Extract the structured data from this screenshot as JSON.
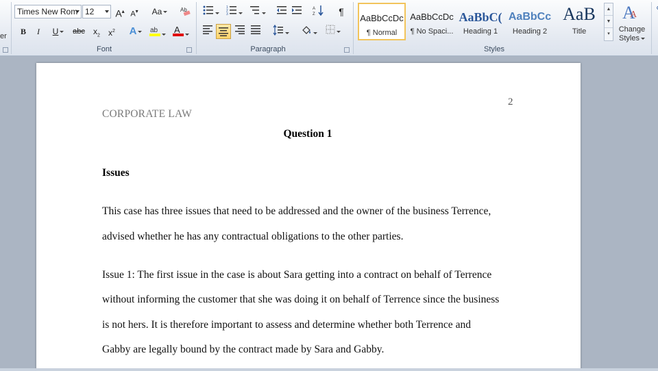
{
  "ribbon": {
    "clipboard_partial_label": "er",
    "font": {
      "family": "Times New Rom",
      "size": "12",
      "group_label": "Font"
    },
    "paragraph": {
      "group_label": "Paragraph"
    },
    "styles": {
      "group_label": "Styles",
      "tiles": [
        {
          "preview": "AaBbCcDc",
          "name": "¶ Normal"
        },
        {
          "preview": "AaBbCcDc",
          "name": "¶ No Spaci..."
        },
        {
          "preview": "AaBbC(",
          "name": "Heading 1"
        },
        {
          "preview": "AaBbCc",
          "name": "Heading 2"
        },
        {
          "preview": "AaB",
          "name": "Title"
        }
      ],
      "change_styles_line1": "Change",
      "change_styles_line2": "Styles"
    }
  },
  "document": {
    "page_number": "2",
    "header": "CORPORATE LAW",
    "question_title": "Question 1",
    "issues_heading": "Issues",
    "lines": [
      "This case has three issues that need to be addressed and the owner of the business Terrence,",
      "advised whether he has any contractual obligations to the other parties.",
      "Issue 1: The first issue in the case is about Sara getting into a contract on behalf of Terrence",
      "without informing the customer that she was doing it on behalf of Terrence since the business",
      "is not hers. It is therefore important to assess and determine whether both Terrence and",
      "Gabby are legally bound by the contract made by Sara and Gabby."
    ]
  },
  "colors": {
    "ribbon_bg": "#e4e9f1",
    "workspace_bg": "#abb5c3",
    "active_style_border": "#f2c45b",
    "heading_blue": "#2b579a",
    "header_gray": "#7a7a7a"
  }
}
